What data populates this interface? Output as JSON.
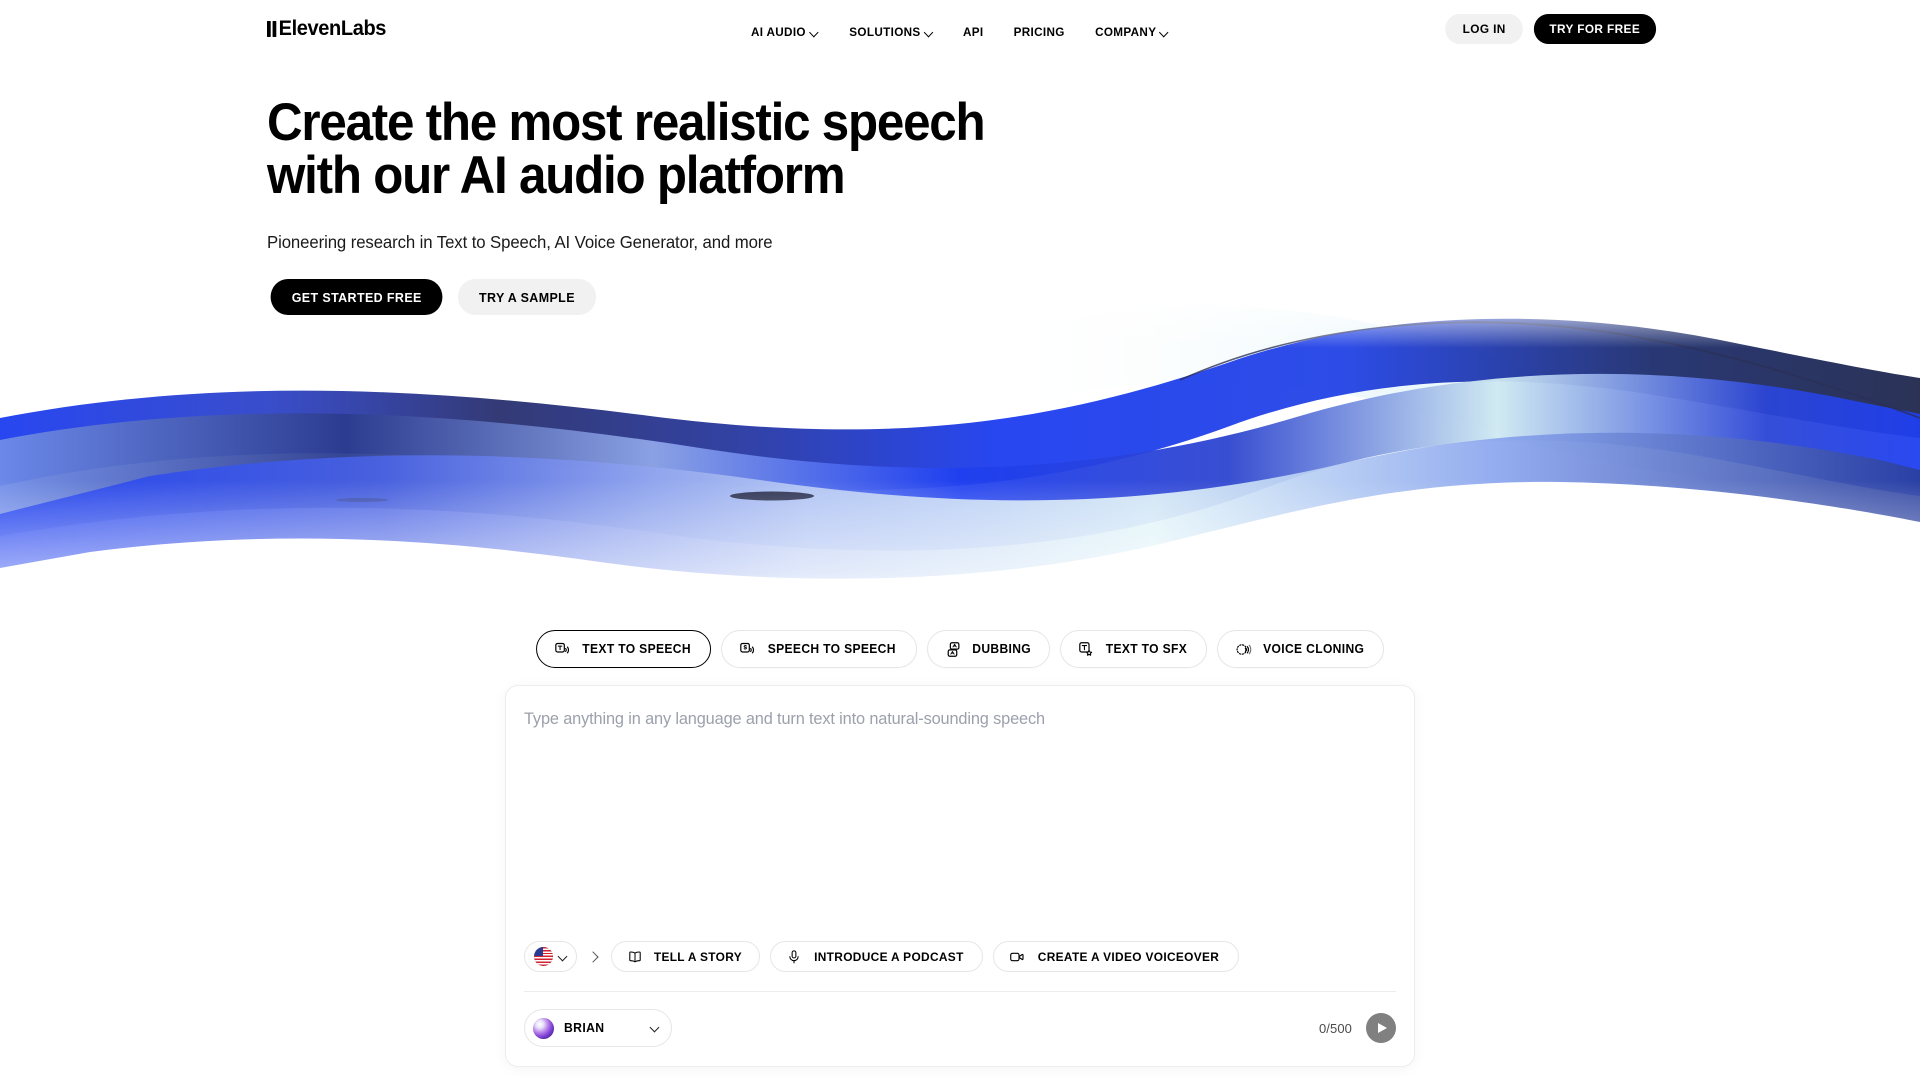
{
  "header": {
    "logo_text": "ElevenLabs",
    "nav": [
      {
        "label": "AI AUDIO",
        "has_dropdown": true
      },
      {
        "label": "SOLUTIONS",
        "has_dropdown": true
      },
      {
        "label": "API",
        "has_dropdown": false
      },
      {
        "label": "PRICING",
        "has_dropdown": false
      },
      {
        "label": "COMPANY",
        "has_dropdown": true
      }
    ],
    "login_label": "LOG IN",
    "try_free_label": "TRY FOR FREE"
  },
  "hero": {
    "heading_line1": "Create the most realistic speech",
    "heading_line2": "with our AI audio platform",
    "subtitle": "Pioneering research in Text to Speech, AI Voice Generator, and more",
    "cta_primary": "GET STARTED FREE",
    "cta_secondary": "TRY A SAMPLE"
  },
  "wave": {
    "colors": {
      "blue_bright": "#1f3ff0",
      "blue_mid": "#2c4fe0",
      "navy_dark": "#232a4e",
      "pale_cyan": "#dff3f8",
      "light_blue": "#9db4ef"
    }
  },
  "tabs": [
    {
      "label": "TEXT TO SPEECH",
      "icon": "text-to-speech-icon",
      "active": true
    },
    {
      "label": "SPEECH TO SPEECH",
      "icon": "speech-to-speech-icon",
      "active": false
    },
    {
      "label": "DUBBING",
      "icon": "dubbing-icon",
      "active": false
    },
    {
      "label": "TEXT TO SFX",
      "icon": "text-to-sfx-icon",
      "active": false
    },
    {
      "label": "VOICE CLONING",
      "icon": "voice-cloning-icon",
      "active": false
    }
  ],
  "card": {
    "placeholder": "Type anything in any language and turn text into natural-sounding speech",
    "value": "",
    "language": {
      "name": "English (US)",
      "icon": "us-flag-icon"
    },
    "action_chips": [
      {
        "label": "TELL A STORY",
        "icon": "book-icon"
      },
      {
        "label": "INTRODUCE A PODCAST",
        "icon": "microphone-icon"
      },
      {
        "label": "CREATE A VIDEO VOICEOVER",
        "icon": "video-camera-icon"
      }
    ],
    "voice": {
      "name": "BRIAN"
    },
    "char_counter": "0/500",
    "play_label": "Play"
  }
}
